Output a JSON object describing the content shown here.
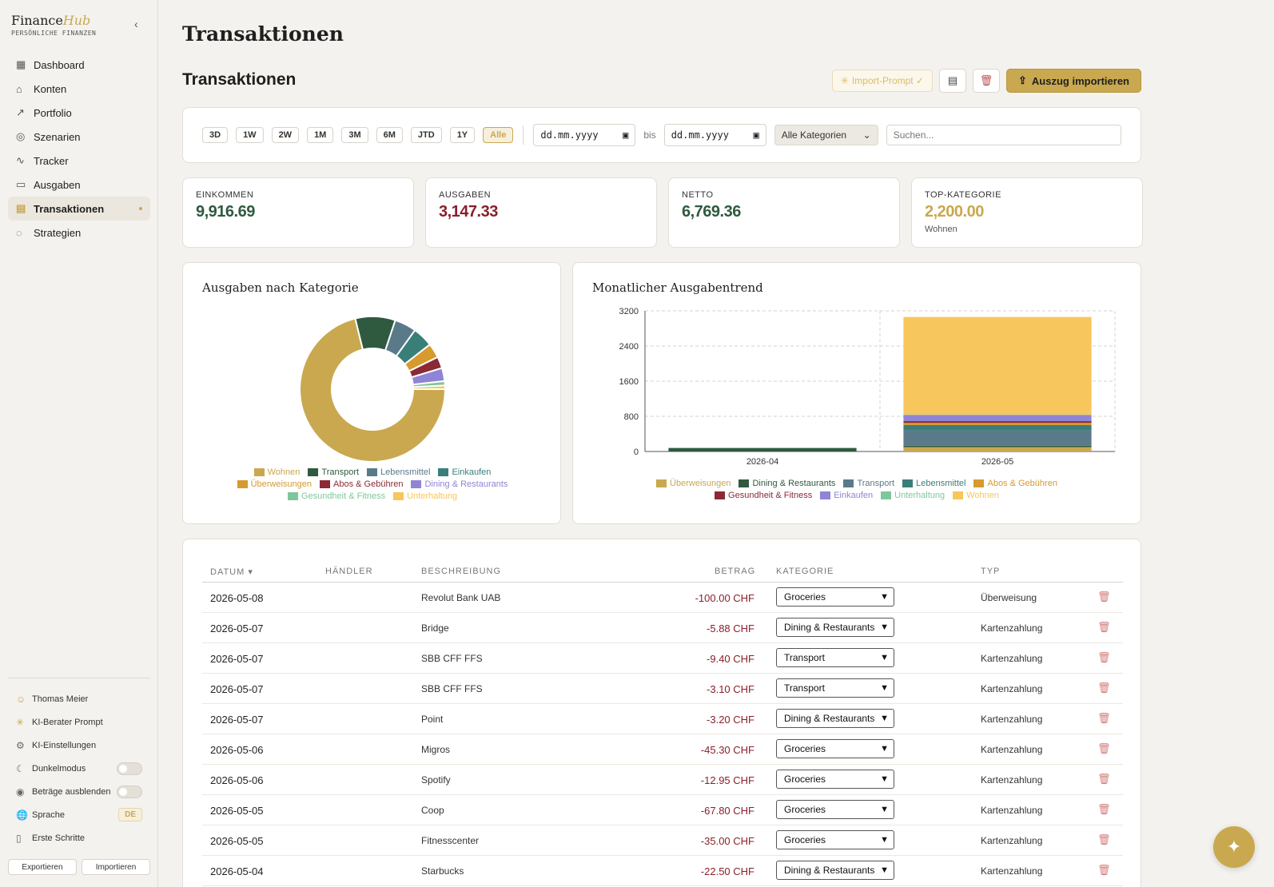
{
  "brand": {
    "name_part1": "Finance",
    "name_part2": "Hub",
    "subtitle": "PERSÖNLICHE FINANZEN"
  },
  "nav": [
    {
      "label": "Dashboard",
      "icon": "dashboard-icon",
      "glyph": "▦"
    },
    {
      "label": "Konten",
      "icon": "bank-icon",
      "glyph": "⌂"
    },
    {
      "label": "Portfolio",
      "icon": "trend-up-icon",
      "glyph": "↗"
    },
    {
      "label": "Szenarien",
      "icon": "target-icon",
      "glyph": "◎"
    },
    {
      "label": "Tracker",
      "icon": "pulse-icon",
      "glyph": "∿"
    },
    {
      "label": "Ausgaben",
      "icon": "card-icon",
      "glyph": "▭"
    },
    {
      "label": "Transaktionen",
      "icon": "receipt-icon",
      "glyph": "▤",
      "active": true
    },
    {
      "label": "Strategien",
      "icon": "piggy-bank-icon",
      "glyph": "◌"
    }
  ],
  "sidebar_bottom": {
    "user": "Thomas Meier",
    "ai_prompt": "KI-Berater Prompt",
    "ai_settings": "KI-Einstellungen",
    "dark_mode": "Dunkelmodus",
    "hide_amounts": "Beträge ausblenden",
    "language": "Sprache",
    "language_value": "DE",
    "getting_started": "Erste Schritte",
    "export": "Exportieren",
    "import": "Importieren"
  },
  "page": {
    "title": "Transaktionen",
    "section_title": "Transaktionen",
    "import_prompt": "Import-Prompt ✓",
    "import_statement": "Auszug importieren"
  },
  "filters": {
    "ranges": [
      "3D",
      "1W",
      "2W",
      "1M",
      "3M",
      "6M",
      "JTD",
      "1Y",
      "Alle"
    ],
    "active_range": "Alle",
    "date_placeholder": "dd.mm.yyyy",
    "bis": "bis",
    "category": "Alle Kategorien",
    "search_placeholder": "Suchen..."
  },
  "kpis": [
    {
      "label": "EINKOMMEN",
      "value": "9,916.69",
      "color": "#2f5a3f"
    },
    {
      "label": "AUSGABEN",
      "value": "3,147.33",
      "color": "#8a1f2b"
    },
    {
      "label": "NETTO",
      "value": "6,769.36",
      "color": "#2f5a3f"
    },
    {
      "label": "TOP-KATEGORIE",
      "value": "2,200.00",
      "color": "#c9a84f",
      "sub": "Wohnen"
    }
  ],
  "colors": {
    "Wohnen": "#c9a84f",
    "Transport": "#2f5a3f",
    "Lebensmittel": "#5a7a8a",
    "Einkaufen": "#3a7e7a",
    "Überweisungen": "#d69a2e",
    "Abos & Gebühren": "#8a2a35",
    "Dining & Restaurants": "#8f84d6",
    "Gesundheit & Fitness": "#7fc79a",
    "Unterhaltung": "#f7c65c"
  },
  "chart_data": [
    {
      "type": "pie",
      "title": "Ausgaben nach Kategorie",
      "categories": [
        "Wohnen",
        "Transport",
        "Lebensmittel",
        "Einkaufen",
        "Überweisungen",
        "Abos & Gebühren",
        "Dining & Restaurants",
        "Gesundheit & Fitness",
        "Unterhaltung"
      ],
      "values": [
        2200,
        275,
        150,
        140,
        100,
        80,
        90,
        30,
        25
      ],
      "legend_colors": [
        "#c9a84f",
        "#2f5a3f",
        "#5a7a8a",
        "#3a7e7a",
        "#d69a2e",
        "#8a2a35",
        "#8f84d6",
        "#7fc79a",
        "#f7c65c"
      ],
      "legend_text_colors": [
        "#c9a84f",
        "#2f5a3f",
        "#5a7a8a",
        "#3a7e7a",
        "#d69a2e",
        "#8a2a35",
        "#8f84d6",
        "#7fc79a",
        "#f7c65c"
      ],
      "legend": "bottom"
    },
    {
      "type": "bar",
      "stacked": true,
      "title": "Monatlicher Ausgabentrend",
      "categories": [
        "2026-04",
        "2026-05"
      ],
      "ylim": [
        0,
        3200
      ],
      "yticks": [
        0,
        800,
        1600,
        2400,
        3200
      ],
      "grid": true,
      "legend": "bottom",
      "series": [
        {
          "name": "Überweisungen",
          "color": "#c9a84f",
          "values": [
            0,
            100
          ]
        },
        {
          "name": "Dining & Restaurants",
          "color": "#2f5a3f",
          "values": [
            80,
            30
          ]
        },
        {
          "name": "Transport",
          "color": "#5a7a8a",
          "values": [
            0,
            350
          ]
        },
        {
          "name": "Lebensmittel",
          "color": "#3a7e7a",
          "values": [
            0,
            120
          ]
        },
        {
          "name": "Abos & Gebühren",
          "color": "#d69a2e",
          "values": [
            0,
            50
          ]
        },
        {
          "name": "Gesundheit & Fitness",
          "color": "#8a2a35",
          "values": [
            0,
            40
          ]
        },
        {
          "name": "Einkaufen",
          "color": "#8f84d6",
          "values": [
            0,
            140
          ]
        },
        {
          "name": "Unterhaltung",
          "color": "#7fc79a",
          "values": [
            0,
            10
          ]
        },
        {
          "name": "Wohnen",
          "color": "#f7c65c",
          "values": [
            0,
            2220
          ]
        }
      ]
    }
  ],
  "table": {
    "headers": {
      "date": "DATUM ▾",
      "merchant": "HÄNDLER",
      "description": "BESCHREIBUNG",
      "amount": "BETRAG",
      "category": "KATEGORIE",
      "type": "TYP"
    },
    "rows": [
      {
        "date": "2026-05-08",
        "merchant": "",
        "description": "Revolut Bank UAB",
        "amount": "-100.00 CHF",
        "category": "Groceries",
        "type": "Überweisung"
      },
      {
        "date": "2026-05-07",
        "merchant": "",
        "description": "Bridge",
        "amount": "-5.88 CHF",
        "category": "Dining & Restaurants",
        "type": "Kartenzahlung"
      },
      {
        "date": "2026-05-07",
        "merchant": "",
        "description": "SBB CFF FFS",
        "amount": "-9.40 CHF",
        "category": "Transport",
        "type": "Kartenzahlung"
      },
      {
        "date": "2026-05-07",
        "merchant": "",
        "description": "SBB CFF FFS",
        "amount": "-3.10 CHF",
        "category": "Transport",
        "type": "Kartenzahlung"
      },
      {
        "date": "2026-05-07",
        "merchant": "",
        "description": "Point",
        "amount": "-3.20 CHF",
        "category": "Dining & Restaurants",
        "type": "Kartenzahlung"
      },
      {
        "date": "2026-05-06",
        "merchant": "",
        "description": "Migros",
        "amount": "-45.30 CHF",
        "category": "Groceries",
        "type": "Kartenzahlung"
      },
      {
        "date": "2026-05-06",
        "merchant": "",
        "description": "Spotify",
        "amount": "-12.95 CHF",
        "category": "Groceries",
        "type": "Kartenzahlung"
      },
      {
        "date": "2026-05-05",
        "merchant": "",
        "description": "Coop",
        "amount": "-67.80 CHF",
        "category": "Groceries",
        "type": "Kartenzahlung"
      },
      {
        "date": "2026-05-05",
        "merchant": "",
        "description": "Fitnesscenter",
        "amount": "-35.00 CHF",
        "category": "Groceries",
        "type": "Kartenzahlung"
      },
      {
        "date": "2026-05-04",
        "merchant": "",
        "description": "Starbucks",
        "amount": "-22.50 CHF",
        "category": "Dining & Restaurants",
        "type": "Kartenzahlung"
      }
    ]
  }
}
